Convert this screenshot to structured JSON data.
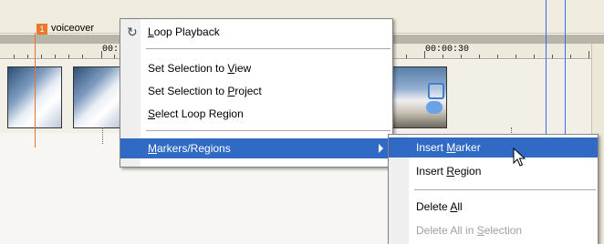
{
  "timeline": {
    "marker_number": "1",
    "marker_name": "voiceover",
    "ruler_labels": [
      "00:",
      "00:00:30",
      "00"
    ]
  },
  "context_menu": {
    "loop_playback": {
      "pre": "",
      "acc": "L",
      "post": "oop Playback"
    },
    "set_selection_view": {
      "pre": "Set Selection to ",
      "acc": "V",
      "post": "iew"
    },
    "set_selection_project": {
      "pre": "Set Selection to ",
      "acc": "P",
      "post": "roject"
    },
    "select_loop_region": {
      "pre": "",
      "acc": "S",
      "post": "elect Loop Region"
    },
    "markers_regions": {
      "pre": "",
      "acc": "M",
      "post": "arkers/Regions"
    }
  },
  "submenu": {
    "insert_marker": {
      "pre": "Insert ",
      "acc": "M",
      "post": "arker"
    },
    "insert_region": {
      "pre": "Insert ",
      "acc": "R",
      "post": "egion"
    },
    "delete_all": {
      "pre": "Delete ",
      "acc": "A",
      "post": "ll"
    },
    "delete_all_in_selection": {
      "pre": "Delete All in ",
      "acc": "S",
      "post": "election"
    }
  },
  "icons": {
    "refresh": "refresh-icon",
    "submenu_arrow": "chevron-right-icon",
    "cursor": "mouse-pointer-icon"
  },
  "colors": {
    "highlight": "#316ac5",
    "marker": "#e8782c",
    "time_line": "#3a6cf0"
  }
}
